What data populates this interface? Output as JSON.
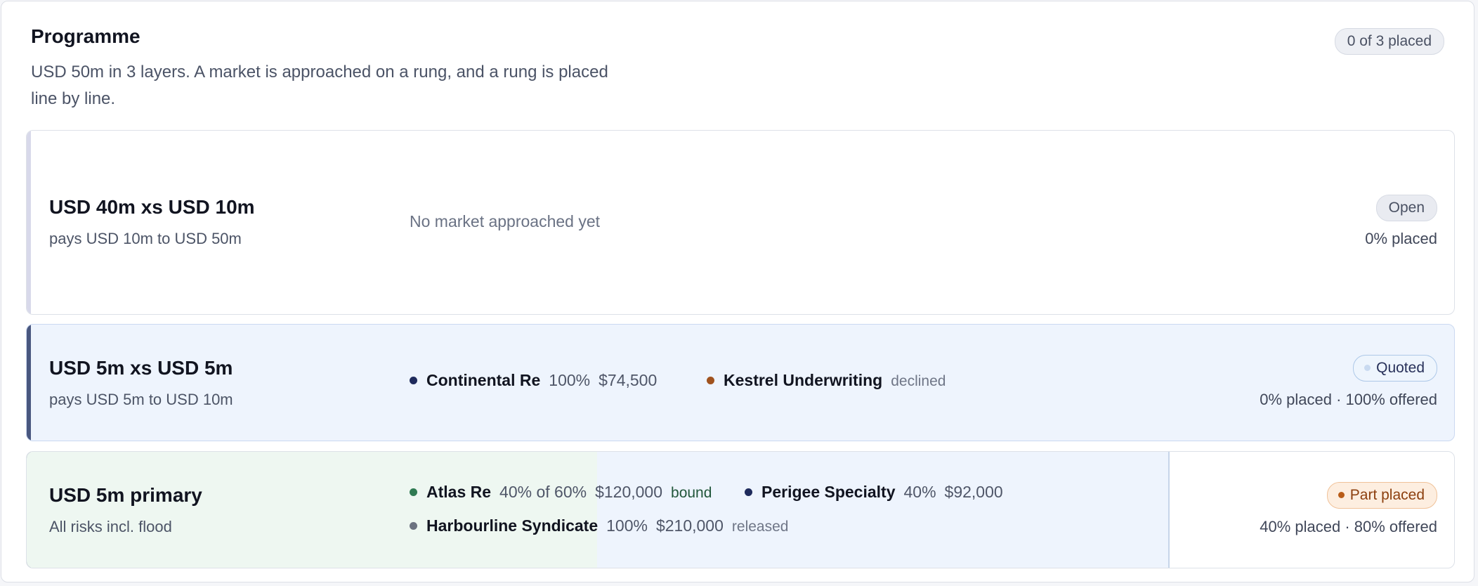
{
  "programme": {
    "title": "Programme",
    "description": "USD 50m in 3 layers. A market is approached on a rung, and a rung is placed line by line.",
    "summary": "0 of 3 placed"
  },
  "layers": [
    {
      "name": "USD 40m xs USD 10m",
      "description": "pays USD 10m to USD 50m",
      "empty_note": "No market approached yet",
      "status": "Open",
      "placement": "0% placed"
    },
    {
      "name": "USD 5m xs USD 5m",
      "description": "pays USD 5m to USD 10m",
      "status": "Quoted",
      "placement": "0% placed · 100% offered",
      "markets": [
        {
          "name": "Continental Re",
          "share": "100%",
          "premium": "$74,500",
          "dot_color": "#1e2a5c"
        },
        {
          "name": "Kestrel Underwriting",
          "state": "declined",
          "dot_color": "#a0521e"
        }
      ]
    },
    {
      "name": "USD 5m primary",
      "description": "All risks incl. flood",
      "status": "Part placed",
      "placement": "40% placed · 80% offered",
      "bound_fraction": 0.4,
      "offered_fraction": 0.8,
      "markets": [
        {
          "name": "Atlas Re",
          "share": "40% of 60%",
          "premium": "$120,000",
          "state": "bound",
          "dot_color": "#2f7a52"
        },
        {
          "name": "Perigee Specialty",
          "share": "40%",
          "premium": "$92,000",
          "dot_color": "#1e2a5c"
        },
        {
          "name": "Harbourline Syndicate",
          "share": "100%",
          "premium": "$210,000",
          "state": "released",
          "dot_color": "#6b7280"
        }
      ]
    }
  ],
  "colors": {
    "quoted_dot": "#c9daf0",
    "part_placed_dot": "#b95c18"
  }
}
